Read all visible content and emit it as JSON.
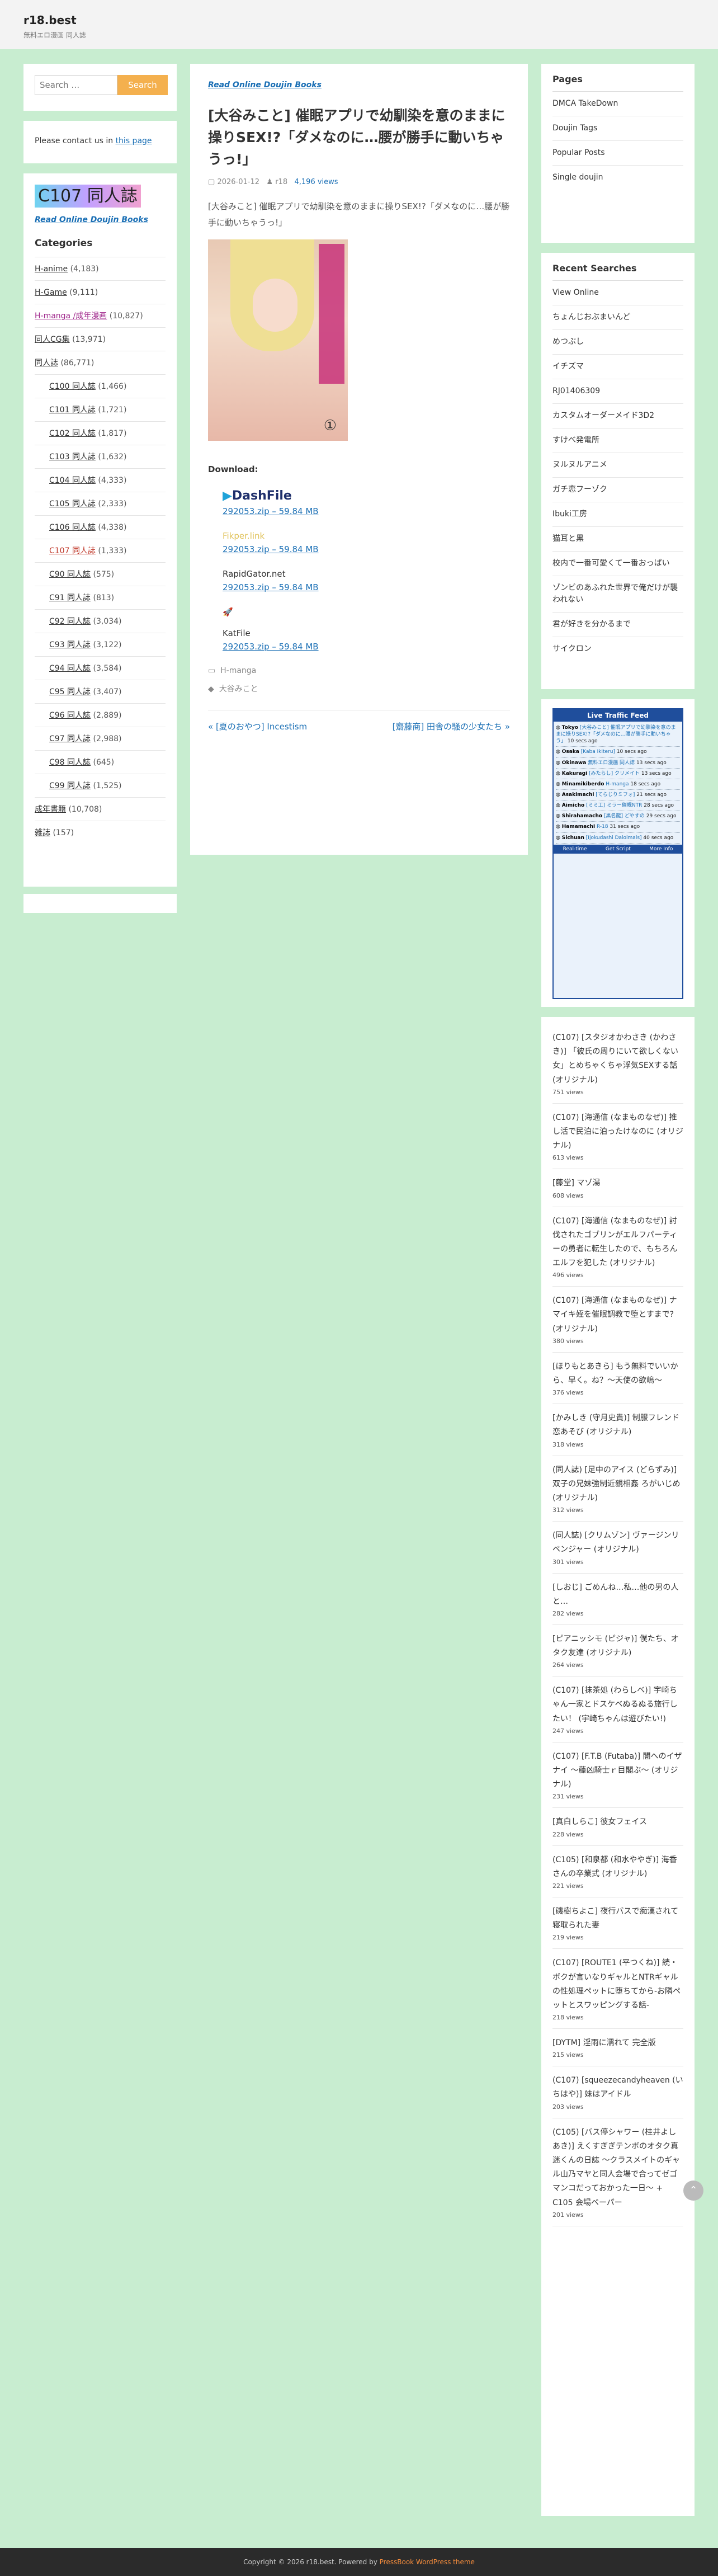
{
  "site": {
    "title": "r18.best",
    "tagline": "無料エロ漫画 同人誌"
  },
  "search": {
    "placeholder": "Search …",
    "button": "Search"
  },
  "contact": {
    "text": "Please contact us in ",
    "link": "this page"
  },
  "categories_widget": {
    "banner": "C107 同人誌",
    "read_link": "Read Online Doujin Books",
    "title": "Categories",
    "items": [
      {
        "name": "H-anime",
        "count": "(4,183)",
        "sub": false
      },
      {
        "name": "H-Game",
        "count": "(9,111)",
        "sub": false
      },
      {
        "name": "H-manga /成年漫画",
        "count": "(10,827)",
        "sub": false,
        "color": "#a0288c"
      },
      {
        "name": "同人CG集",
        "count": "(13,971)",
        "sub": false
      },
      {
        "name": "同人誌",
        "count": "(86,771)",
        "sub": false
      },
      {
        "name": "C100 同人誌",
        "count": "(1,466)",
        "sub": true
      },
      {
        "name": "C101 同人誌",
        "count": "(1,721)",
        "sub": true
      },
      {
        "name": "C102 同人誌",
        "count": "(1,817)",
        "sub": true
      },
      {
        "name": "C103 同人誌",
        "count": "(1,632)",
        "sub": true
      },
      {
        "name": "C104 同人誌",
        "count": "(4,333)",
        "sub": true
      },
      {
        "name": "C105 同人誌",
        "count": "(2,333)",
        "sub": true
      },
      {
        "name": "C106 同人誌",
        "count": "(4,338)",
        "sub": true
      },
      {
        "name": "C107 同人誌",
        "count": "(1,333)",
        "sub": true,
        "color": "#c0392b"
      },
      {
        "name": "C90 同人誌",
        "count": "(575)",
        "sub": true
      },
      {
        "name": "C91 同人誌",
        "count": "(813)",
        "sub": true
      },
      {
        "name": "C92 同人誌",
        "count": "(3,034)",
        "sub": true
      },
      {
        "name": "C93 同人誌",
        "count": "(3,122)",
        "sub": true
      },
      {
        "name": "C94 同人誌",
        "count": "(3,584)",
        "sub": true
      },
      {
        "name": "C95 同人誌",
        "count": "(3,407)",
        "sub": true
      },
      {
        "name": "C96 同人誌",
        "count": "(2,889)",
        "sub": true
      },
      {
        "name": "C97 同人誌",
        "count": "(2,988)",
        "sub": true
      },
      {
        "name": "C98 同人誌",
        "count": "(645)",
        "sub": true
      },
      {
        "name": "C99 同人誌",
        "count": "(1,525)",
        "sub": true
      },
      {
        "name": "成年書籍",
        "count": "(10,708)",
        "sub": false
      },
      {
        "name": "雑誌",
        "count": "(157)",
        "sub": false
      }
    ]
  },
  "article": {
    "category": "Read Online Doujin Books",
    "title": "[大谷みこと] 催眠アプリで幼馴染を意のままに操りSEX!?「ダメなのに…腰が勝手に動いちゃうっ!」",
    "date": "2026-01-12",
    "author": "r18",
    "views": "4,196 views",
    "excerpt": "[大谷みこと] 催眠アプリで幼馴染を意のままに操りSEX!?「ダメなのに…腰が勝手に動いちゃうっ!」",
    "cover_number": "①",
    "download_label": "Download:",
    "downloads": [
      {
        "brand": "DashFile",
        "link": "292053.zip – 59.84 MB"
      },
      {
        "brand": "Fikper.link",
        "link": "292053.zip – 59.84 MB"
      },
      {
        "brand": "RapidGator.net",
        "link": "292053.zip – 59.84 MB"
      },
      {
        "brand": "KatFile",
        "link": "292053.zip – 59.84 MB"
      }
    ],
    "category_tag": "H-manga",
    "author_tag": "大谷みこと",
    "prev": "« [夏のおやつ] Incestism",
    "next": "[齋藤商] 田舎の騒の少女たち »"
  },
  "pages_widget": {
    "title": "Pages",
    "items": [
      "DMCA TakeDown",
      "Doujin Tags",
      "Popular Posts",
      "Single doujin"
    ]
  },
  "recent_widget": {
    "title": "Recent Searches",
    "items": [
      "View Online",
      "ちょんじおぶまいんど",
      "めつぶし",
      "イチズマ",
      "RJ01406309",
      "カスタムオーダーメイド3D2",
      "すけべ発電所",
      "ヌルヌルアニメ",
      "ガチ恋フーゾク",
      "Ibuki工房",
      "猫耳と黒",
      "校内で一番可愛くて一番おっぱい",
      "ゾンビのあふれた世界で俺だけが襲われない",
      "君が好きを分かるまで",
      "サイクロン"
    ]
  },
  "traffic_widget": {
    "title": "Live Traffic Feed",
    "entries": [
      {
        "city": "Tokyo",
        "page": "[大谷みこと] 催眠アプリで幼馴染を意のままに操りSEX!?「ダメなのに…腰が勝手に動いちゃう」",
        "ago": "10 secs ago"
      },
      {
        "city": "Osaka",
        "page": "[Kaba Ikiteru]",
        "ago": "10 secs ago"
      },
      {
        "city": "Okinawa",
        "page": "無料エロ漫画 同人誌",
        "ago": "13 secs ago"
      },
      {
        "city": "Kakuragi",
        "page": "[みたらし] クリメイト",
        "ago": "13 secs ago"
      },
      {
        "city": "Minamikiberdo",
        "page": "H-manga",
        "ago": "18 secs ago"
      },
      {
        "city": "Asakimachi",
        "page": "[てらじりミフォ]",
        "ago": "21 secs ago"
      },
      {
        "city": "Aimicho",
        "page": "[ミミ工] ミラー催眠NTR",
        "ago": "28 secs ago"
      },
      {
        "city": "Shirahamacho",
        "page": "[黒名龍] どやすの",
        "ago": "29 secs ago"
      },
      {
        "city": "Hamamachi",
        "page": "R-18",
        "ago": "31 secs ago"
      },
      {
        "city": "Sichuan",
        "page": "[Ijokudashi Dalolmals]",
        "ago": "40 secs ago"
      }
    ],
    "foot": [
      "Real-time",
      "Get Script",
      "More Info"
    ]
  },
  "popular_widget": {
    "items": [
      {
        "title": "(C107) [スタジオかわさき (かわさき)] 「彼氏の周りにいて欲しくない女」とめちゃくちゃ浮気SEXする話 (オリジナル)",
        "views": "751 views"
      },
      {
        "title": "(C107) [海通信 (なまものなぜ)] 推し活で民泊に泊ったけなのに (オリジナル)",
        "views": "613 views"
      },
      {
        "title": "[藤堂] マゾ湯",
        "views": "608 views"
      },
      {
        "title": "(C107) [海通信 (なまものなぜ)] 討伐されたゴブリンがエルフパーティーの勇者に転生したので、もちろんエルフを犯した (オリジナル)",
        "views": "496 views"
      },
      {
        "title": "(C107) [海通信 (なまものなぜ)] ナマイキ姪を催眠調教で堕とすまで? (オリジナル)",
        "views": "380 views"
      },
      {
        "title": "[ほりもとあきら] もう無料でいいから、早く。ね？〜天使の欲嶋〜",
        "views": "376 views"
      },
      {
        "title": "[かみしき (守月史貴)] 制服フレンド恋あそび (オリジナル)",
        "views": "318 views"
      },
      {
        "title": "(同人誌) [足中のアイス (どらずみ)] 双子の兄妹強制近親相姦 ろがいじめ (オリジナル)",
        "views": "312 views"
      },
      {
        "title": "(同人誌) [クリムゾン] ヴァージンリベンジャー (オリジナル)",
        "views": "301 views"
      },
      {
        "title": "[しおじ] ごめんね…私…他の男の人と…",
        "views": "282 views"
      },
      {
        "title": "[ピアニッシモ (ピジャ)] 僕たち、オタク友達 (オリジナル)",
        "views": "264 views"
      },
      {
        "title": "(C107) [抹茶処 (わらしべ)] 宇崎ちゃん一家とドスケベぬるぬる旅行したい！ (宇崎ちゃんは遊びたい!)",
        "views": "247 views"
      },
      {
        "title": "(C107) [F.T.B (Futaba)] 闇へのイザナイ 〜藤凶騎士ｒ目閣ぶ〜 (オリジナル)",
        "views": "231 views"
      },
      {
        "title": "[真白しらこ] 彼女フェイス",
        "views": "228 views"
      },
      {
        "title": "(C105) [和泉都 (和水ややぎ)] 海香さんの卒業式 (オリジナル)",
        "views": "221 views"
      },
      {
        "title": "[磯樹ちよこ] 夜行バスで痴漢されて寝取られた妻",
        "views": "219 views"
      },
      {
        "title": "(C107) [ROUTE1 (平つくね)] 続・ボクが言いなりギャルとNTRギャルの性処理ペットに堕ちてから-お隣ペットとスワッピングする話-",
        "views": "218 views"
      },
      {
        "title": "[DYTM] 淫雨に濡れて 完全版",
        "views": "215 views"
      },
      {
        "title": "(C107) [squeezecandyheaven (いちはや)] 妹はアイドル",
        "views": "203 views"
      },
      {
        "title": "(C105) [バス停シャワー (桂井よしあき)] えくすぎぎテンボのオタク真迷くんの日誌 〜クラスメイトのギャル山乃マヤと同人会場で合ってゼゴマンコだっておかった一日〜 + C105 会場ペーパー",
        "views": "201 views"
      }
    ]
  },
  "footer": {
    "copyright": "Copyright © 2026 r18.best. Powered by ",
    "link": "PressBook WordPress theme"
  },
  "colors": {
    "bg": "#c8edd0",
    "accent": "#f4b04e",
    "link": "#1a6fb5",
    "footer": "#2b2b2b"
  }
}
